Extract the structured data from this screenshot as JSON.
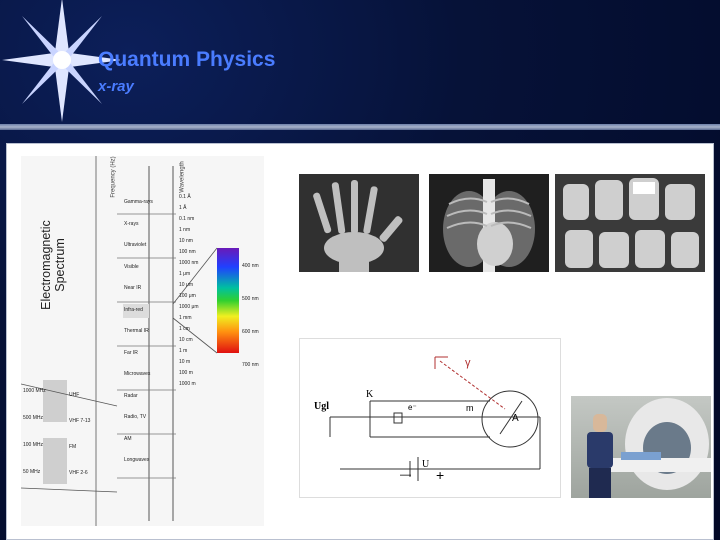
{
  "slide": {
    "title": "Quantum Physics",
    "subtitle": "x-ray"
  },
  "spectrum": {
    "heading_line1": "Electromagnetic",
    "heading_line2": "Spectrum",
    "axis_frequency": "Frequency (Hz)",
    "axis_wavelength": "Wavelength",
    "bands": [
      "Gamma-rays",
      "X-rays",
      "Ultraviolet",
      "Visible",
      "Near IR",
      "Infra-red",
      "Thermal IR",
      "Far IR",
      "Microwaves",
      "Radar",
      "Radio, TV",
      "AM",
      "Longwaves"
    ],
    "wavelength_ticks": [
      "0.1 Å",
      "1 Å",
      "0.1 nm",
      "1 nm",
      "10 nm",
      "100 nm",
      "1000 nm",
      "1 μm",
      "10 μm",
      "100 μm",
      "1000 μm",
      "1 mm",
      "1 cm",
      "10 cm",
      "1 m",
      "10 m",
      "100 m",
      "1000 m"
    ],
    "visible_ticks": [
      "400 nm",
      "500 nm",
      "600 nm",
      "700 nm"
    ],
    "left_freq": [
      "1000 MHz",
      "500 MHz",
      "100 MHz",
      "50 MHz"
    ],
    "left_bands": [
      "UHF",
      "VHF 7-13",
      "FM",
      "VHF 2-6"
    ]
  },
  "diagram": {
    "label_gamma": "γ",
    "label_K": "K",
    "label_electron": "e⁻",
    "label_m": "m",
    "label_A": "A",
    "label_Ugl": "Ugl",
    "label_U": "U",
    "minus": "—",
    "plus": "+"
  }
}
